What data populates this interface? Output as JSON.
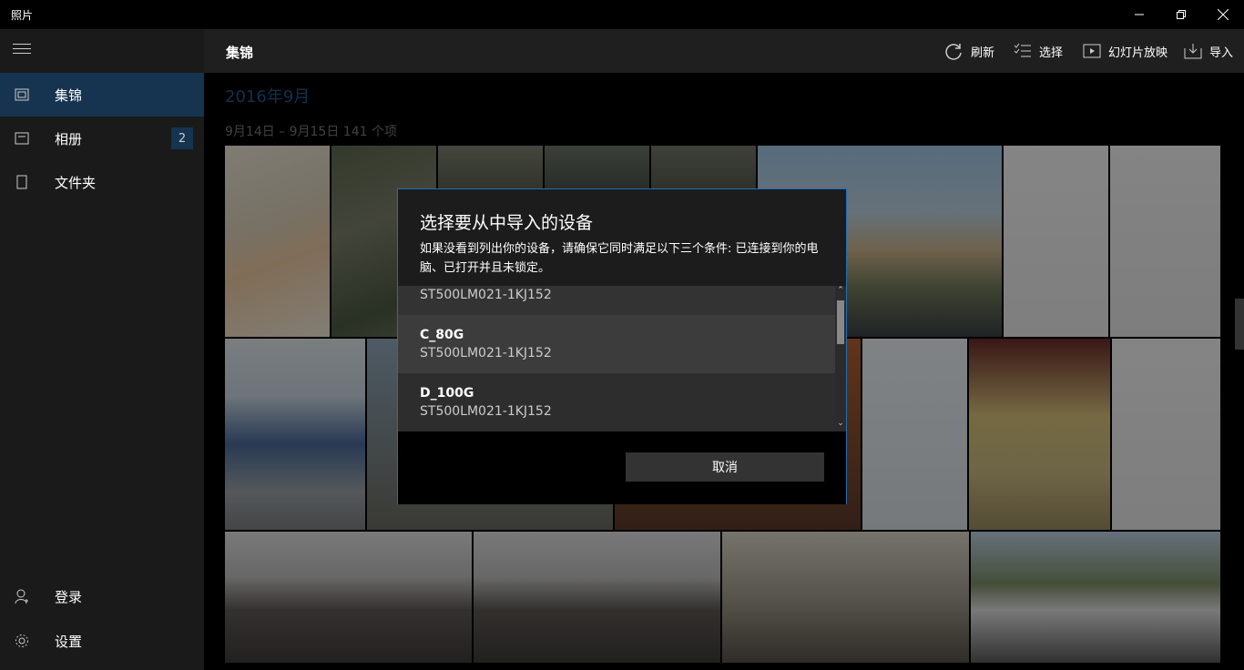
{
  "window": {
    "title": "照片",
    "minimize": "—",
    "maximize": "❐",
    "close": "✕"
  },
  "sidebar": {
    "items": [
      {
        "label": "集锦",
        "icon": "photo-collection-icon"
      },
      {
        "label": "相册",
        "icon": "album-icon",
        "badge": "2"
      },
      {
        "label": "文件夹",
        "icon": "folder-icon"
      }
    ],
    "bottom": [
      {
        "label": "登录",
        "icon": "user-icon"
      },
      {
        "label": "设置",
        "icon": "gear-icon"
      }
    ]
  },
  "header": {
    "title": "集锦",
    "toolbar": [
      {
        "label": "刷新",
        "icon": "refresh-icon"
      },
      {
        "label": "选择",
        "icon": "select-icon"
      },
      {
        "label": "幻灯片放映",
        "icon": "slideshow-icon"
      },
      {
        "label": "导入",
        "icon": "import-icon"
      }
    ]
  },
  "main": {
    "date_heading": "2016年9月",
    "date_range": "9月14日 – 9月15日   141 个项"
  },
  "dialog": {
    "title": "选择要从中导入的设备",
    "description": "如果没看到列出你的设备，请确保它同时满足以下三个条件: 已连接到你的电脑、已打开并且未锁定。",
    "devices": [
      {
        "name": "",
        "subtitle": "ST500LM021-1KJ152"
      },
      {
        "name": "C_80G",
        "subtitle": "ST500LM021-1KJ152"
      },
      {
        "name": "D_100G",
        "subtitle": "ST500LM021-1KJ152"
      }
    ],
    "cancel_label": "取消"
  },
  "colors": {
    "accent": "#1f6fb8",
    "sidebar_active": "#16344f"
  }
}
